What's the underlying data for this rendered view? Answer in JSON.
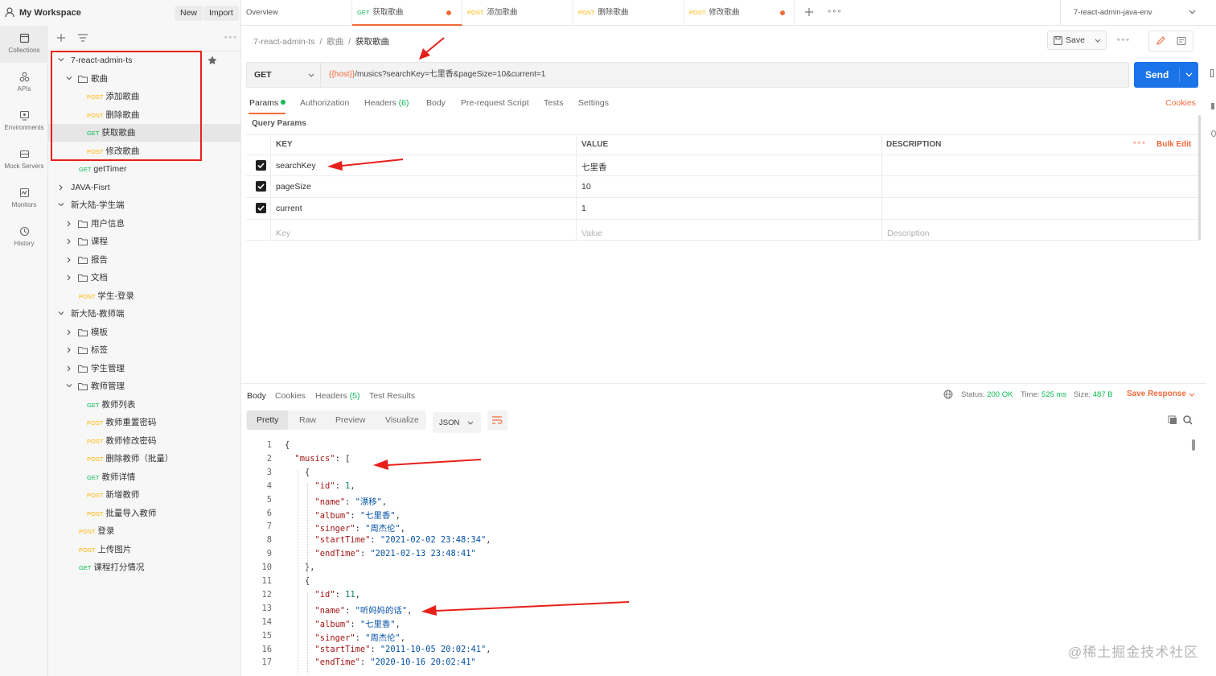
{
  "workspace": {
    "name": "My Workspace",
    "new_label": "New",
    "import_label": "Import"
  },
  "tabs": [
    {
      "label": "Overview",
      "method": ""
    },
    {
      "label": "获取歌曲",
      "method": "GET"
    },
    {
      "label": "添加歌曲",
      "method": "POST"
    },
    {
      "label": "删除歌曲",
      "method": "POST"
    },
    {
      "label": "修改歌曲",
      "method": "POST"
    }
  ],
  "environment": "7-react-admin-java-env",
  "rail": [
    "Collections",
    "APIs",
    "Environments",
    "Mock Servers",
    "Monitors",
    "History"
  ],
  "tree": [
    {
      "label": "7-react-admin-ts"
    },
    {
      "label": "歌曲"
    },
    {
      "method": "POST",
      "label": "添加歌曲"
    },
    {
      "method": "POST",
      "label": "删除歌曲"
    },
    {
      "method": "GET",
      "label": "获取歌曲"
    },
    {
      "method": "POST",
      "label": "修改歌曲"
    },
    {
      "method": "GET",
      "label": "getTimer"
    },
    {
      "label": "JAVA-Fisrt"
    },
    {
      "label": "新大陆-学生端"
    },
    {
      "label": "用户信息"
    },
    {
      "label": "课程"
    },
    {
      "label": "报告"
    },
    {
      "label": "文档"
    },
    {
      "method": "POST",
      "label": "学生-登录"
    },
    {
      "label": "新大陆-教师端"
    },
    {
      "label": "模板"
    },
    {
      "label": "标签"
    },
    {
      "label": "学生管理"
    },
    {
      "label": "教师管理"
    },
    {
      "method": "GET",
      "label": "教师列表"
    },
    {
      "method": "POST",
      "label": "教师重置密码"
    },
    {
      "method": "POST",
      "label": "教师修改密码"
    },
    {
      "method": "POST",
      "label": "删除教师（批量）"
    },
    {
      "method": "GET",
      "label": "教师详情"
    },
    {
      "method": "POST",
      "label": "新增教师"
    },
    {
      "method": "POST",
      "label": "批量导入教师"
    },
    {
      "method": "POST",
      "label": "登录"
    },
    {
      "method": "POST",
      "label": "上传图片"
    },
    {
      "method": "GET",
      "label": "课程打分情况"
    }
  ],
  "breadcrumb": {
    "collection": "7-react-admin-ts",
    "sep": "/",
    "folder": "歌曲",
    "request": "获取歌曲"
  },
  "toolbar": {
    "save_label": "Save"
  },
  "request": {
    "method": "GET",
    "url_var": "{{host}}",
    "url_rest": "/musics?searchKey=七里香&pageSize=10&current=1",
    "send_label": "Send"
  },
  "request_tabs": {
    "params": "Params",
    "authorization": "Authorization",
    "headers": "Headers",
    "headers_count": "(6)",
    "body": "Body",
    "prerequest": "Pre-request Script",
    "tests": "Tests",
    "settings": "Settings",
    "cookies": "Cookies"
  },
  "params": {
    "title": "Query Params",
    "col_key": "KEY",
    "col_value": "VALUE",
    "col_desc": "DESCRIPTION",
    "bulk_edit": "Bulk Edit",
    "rows": [
      {
        "key": "searchKey",
        "value": "七里香",
        "checked": true
      },
      {
        "key": "pageSize",
        "value": "10",
        "checked": true
      },
      {
        "key": "current",
        "value": "1",
        "checked": true
      }
    ],
    "placeholder_key": "Key",
    "placeholder_value": "Value",
    "placeholder_desc": "Description"
  },
  "response": {
    "tabs": {
      "body": "Body",
      "cookies": "Cookies",
      "headers": "Headers",
      "headers_count": "(5)",
      "tests": "Test Results"
    },
    "status_label": "Status:",
    "status": "200 OK",
    "time_label": "Time:",
    "time": "525 ms",
    "size_label": "Size:",
    "size": "487 B",
    "save_response": "Save Response",
    "views": [
      "Pretty",
      "Raw",
      "Preview",
      "Visualize"
    ],
    "format": "JSON",
    "lines": [
      "{",
      "  \"musics\": [",
      "    {",
      "      \"id\": 1,",
      "      \"name\": \"漂移\",",
      "      \"album\": \"七里香\",",
      "      \"singer\": \"周杰伦\",",
      "      \"startTime\": \"2021-02-02 23:48:34\",",
      "      \"endTime\": \"2021-02-13 23:48:41\"",
      "    },",
      "    {",
      "      \"id\": 11,",
      "      \"name\": \"听妈妈的话\",",
      "      \"album\": \"七里香\",",
      "      \"singer\": \"周杰伦\",",
      "      \"startTime\": \"2011-10-05 20:02:41\",",
      "      \"endTime\": \"2020-10-16 20:02:41\""
    ]
  },
  "watermark": "@稀土掘金技术社区",
  "colors": {
    "accent": "#f26b3a",
    "primary": "#1a73e8",
    "get": "#0cbb52",
    "post": "#ffb400",
    "annotation": "#e8201b"
  }
}
